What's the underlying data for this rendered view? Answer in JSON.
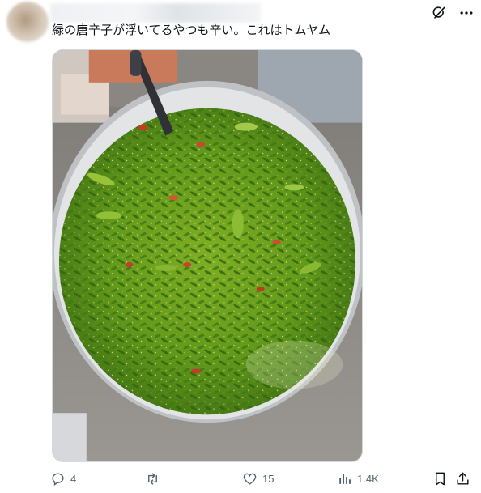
{
  "post": {
    "text": "緑の唐辛子が浮いてるやつも辛い。これはトムヤム"
  },
  "actions": {
    "reply_count": "4",
    "retweet_count": "",
    "like_count": "15",
    "view_count": "1.4K"
  },
  "icons": {
    "top": [
      "grok-icon",
      "more-options-icon"
    ],
    "bar": [
      "reply-icon",
      "retweet-icon",
      "like-icon",
      "views-icon",
      "bookmark-icon",
      "share-icon"
    ]
  },
  "colors": {
    "action_gray": "#536471",
    "text": "#0f1419",
    "border": "#cfd9de",
    "soup_green": "#6a9a1c"
  }
}
